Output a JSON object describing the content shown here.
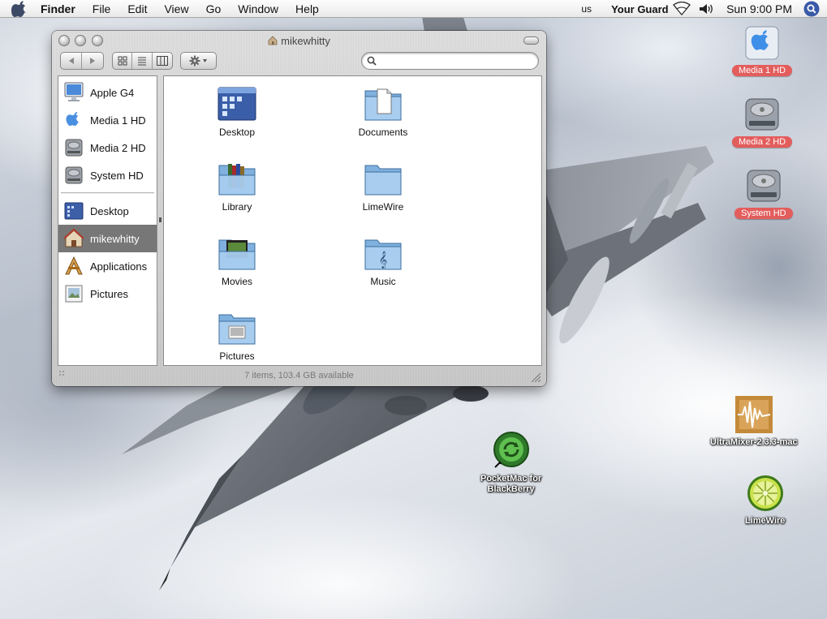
{
  "menubar": {
    "app_name": "Finder",
    "menus": [
      "File",
      "Edit",
      "View",
      "Go",
      "Window",
      "Help"
    ],
    "keyboard": "us",
    "status_item": "Your Guard",
    "clock": "Sun 9:00 PM"
  },
  "window": {
    "title": "mikewhitty",
    "status": "7 items, 103.4 GB available",
    "search": {
      "value": "",
      "placeholder": ""
    },
    "sidebar": {
      "devices": [
        {
          "label": "Apple G4",
          "icon": "computer-icon"
        },
        {
          "label": "Media 1 HD",
          "icon": "apple-disk-icon"
        },
        {
          "label": "Media 2 HD",
          "icon": "hard-disk-icon"
        },
        {
          "label": "System HD",
          "icon": "hard-disk-icon"
        }
      ],
      "places": [
        {
          "label": "Desktop",
          "icon": "desktop-folder-icon",
          "selected": false
        },
        {
          "label": "mikewhitty",
          "icon": "home-icon",
          "selected": true
        },
        {
          "label": "Applications",
          "icon": "applications-icon",
          "selected": false
        },
        {
          "label": "Pictures",
          "icon": "pictures-icon",
          "selected": false
        }
      ]
    },
    "items": [
      {
        "label": "Desktop",
        "icon": "desktop-folder-icon"
      },
      {
        "label": "Documents",
        "icon": "documents-folder-icon"
      },
      {
        "label": "Library",
        "icon": "library-folder-icon"
      },
      {
        "label": "LimeWire",
        "icon": "folder-icon"
      },
      {
        "label": "Movies",
        "icon": "movies-folder-icon"
      },
      {
        "label": "Music",
        "icon": "music-folder-icon"
      },
      {
        "label": "Pictures",
        "icon": "pictures-folder-icon"
      }
    ]
  },
  "desktop": {
    "drives": [
      {
        "label": "Media 1 HD",
        "icon": "apple-disk-icon"
      },
      {
        "label": "Media 2 HD",
        "icon": "hard-disk-icon"
      },
      {
        "label": "System HD",
        "icon": "hard-disk-icon"
      }
    ],
    "pocketmac": {
      "label_line1": "PocketMac for",
      "label_line2": "BlackBerry",
      "icon": "pocketmac-icon"
    },
    "ultramixer": {
      "label": "UltraMixer-2.3.3-mac",
      "icon": "ultramixer-icon"
    },
    "limewire": {
      "label": "LimeWire",
      "icon": "limewire-icon"
    }
  },
  "colors": {
    "selection_gray": "#777777",
    "drive_label_red": "#e35d5d",
    "folder_blue": "#7fb0de"
  }
}
